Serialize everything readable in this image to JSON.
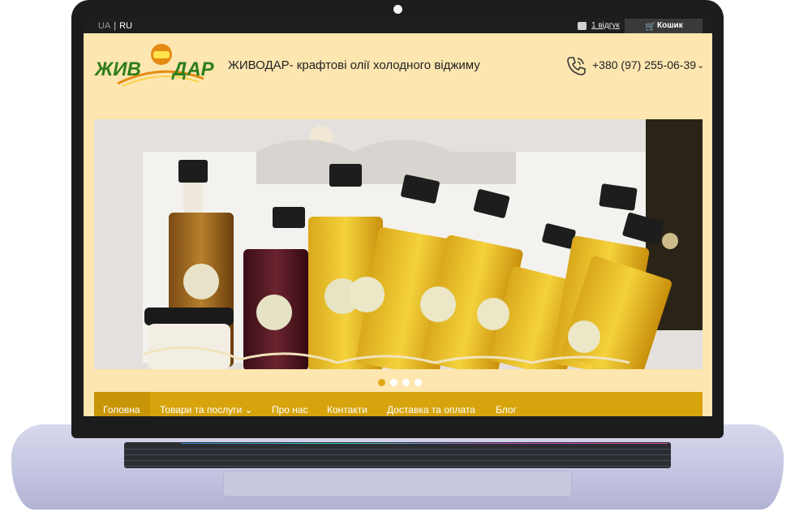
{
  "topbar": {
    "lang_ua": "UA",
    "lang_sep": "|",
    "lang_ru": "RU",
    "reviews_label": "1 відгук",
    "cart_label": "Кошик"
  },
  "header": {
    "logo_text": "ЖИВОДАР",
    "tagline": "ЖИВОДАР- крафтові олії холодного віджиму",
    "phone": "+380 (97) 255-06-39",
    "phone_chevron": "⌄"
  },
  "slider": {
    "slide_count": 4,
    "active_index": 0
  },
  "nav": {
    "items": [
      {
        "label": "Головна"
      },
      {
        "label": "Товари та послуги ⌄"
      },
      {
        "label": "Про нас"
      },
      {
        "label": "Контакти"
      },
      {
        "label": "Доставка та оплата"
      },
      {
        "label": "Блог"
      }
    ]
  },
  "colors": {
    "accent": "#d7a40e",
    "page_bg": "#fde6b0",
    "logo_green": "#2e7d1a",
    "logo_orange": "#e58a12"
  }
}
